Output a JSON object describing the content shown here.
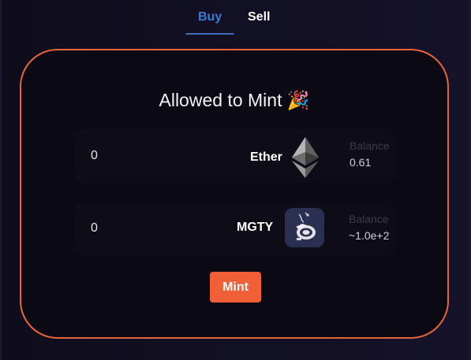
{
  "tabs": [
    {
      "label": "Buy",
      "active": true
    },
    {
      "label": "Sell",
      "active": false
    }
  ],
  "card": {
    "title": "Allowed to Mint 🎉"
  },
  "rows": [
    {
      "amount": "0",
      "token": "Ether",
      "icon": "ethereum-icon",
      "balance_label": "Balance",
      "balance": "0.61"
    },
    {
      "amount": "0",
      "token": "MGTY",
      "icon": "mgty-token-icon",
      "balance_label": "Balance",
      "balance": "~1.0e+2"
    }
  ],
  "mint_label": "Mint",
  "colors": {
    "accent": "#f05f35",
    "border": "#e8643a",
    "tab_active": "#3a7bd5",
    "background": "#110f20"
  }
}
